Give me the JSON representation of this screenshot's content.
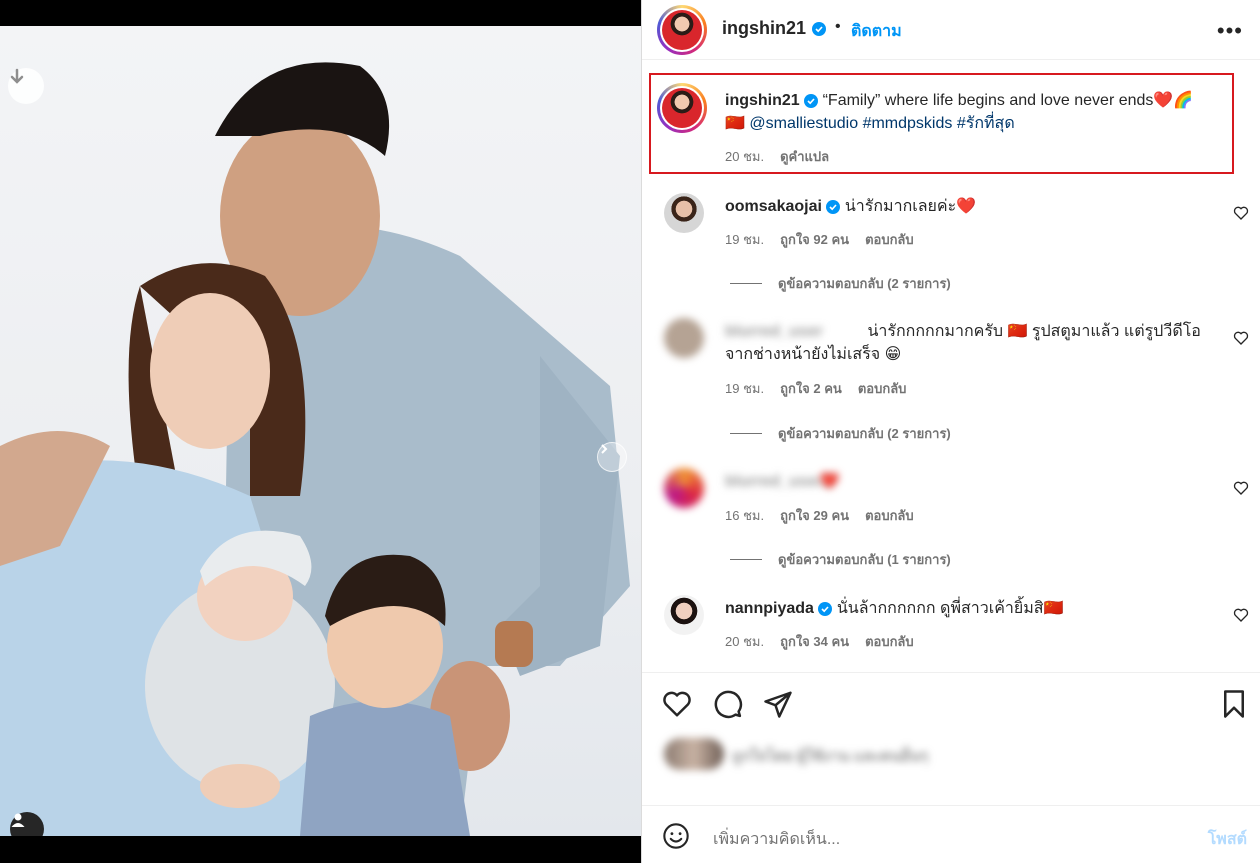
{
  "post": {
    "author": "ingshin21",
    "follow_label": "ติดตาม",
    "dot": "•",
    "more_icon": "more-horizontal-icon",
    "caption": {
      "username": "ingshin21",
      "text": "“Family” where life begins and love never ends❤️🌈",
      "line2_prefix": "🇨🇳",
      "mention": "@smalliestudio",
      "tag1": "#mmdpskids",
      "tag2": "#รักที่สุด",
      "time": "20 ชม.",
      "translate": "ดูคำแปล"
    },
    "highlight_color": "#d7191f"
  },
  "comments": [
    {
      "username": "oomsakaojai",
      "text": "น่ารักมากเลยค่ะ❤️",
      "time": "19 ชม.",
      "likes": "ถูกใจ 92 คน",
      "reply": "ตอบกลับ",
      "view_replies": "ดูข้อความตอบกลับ (2 รายการ)"
    },
    {
      "username": "blurred_user",
      "text": "น่ารักกกกกมากครับ 🇨🇳 รูปสตูมาแล้ว แต่รูปวีดีโอ",
      "text2": "จากช่างหน้ายังไม่เสร็จ 😁",
      "time": "19 ชม.",
      "likes": "ถูกใจ 2 คน",
      "reply": "ตอบกลับ",
      "view_replies": "ดูข้อความตอบกลับ (2 รายการ)"
    },
    {
      "username": "blurred_user2",
      "text": "❤️",
      "time": "16 ชม.",
      "likes": "ถูกใจ 29 คน",
      "reply": "ตอบกลับ",
      "view_replies": "ดูข้อความตอบกลับ (1 รายการ)"
    },
    {
      "username": "nannpiyada",
      "text": "นั่นล้ากกกกกก ดูพี่สาวเค้ายิ้มสิ🇨🇳",
      "time": "20 ชม.",
      "likes": "ถูกใจ 34 คน",
      "reply": "ตอบกลับ"
    }
  ],
  "likes_line": "ถูกใจโดย ผู้ใช้งาน และคนอื่นๆ",
  "add_comment": {
    "placeholder": "เพิ่มความคิดเห็น...",
    "post_label": "โพสต์"
  },
  "colors": {
    "link": "#00376b",
    "follow": "#0095f6",
    "muted": "#737373"
  }
}
